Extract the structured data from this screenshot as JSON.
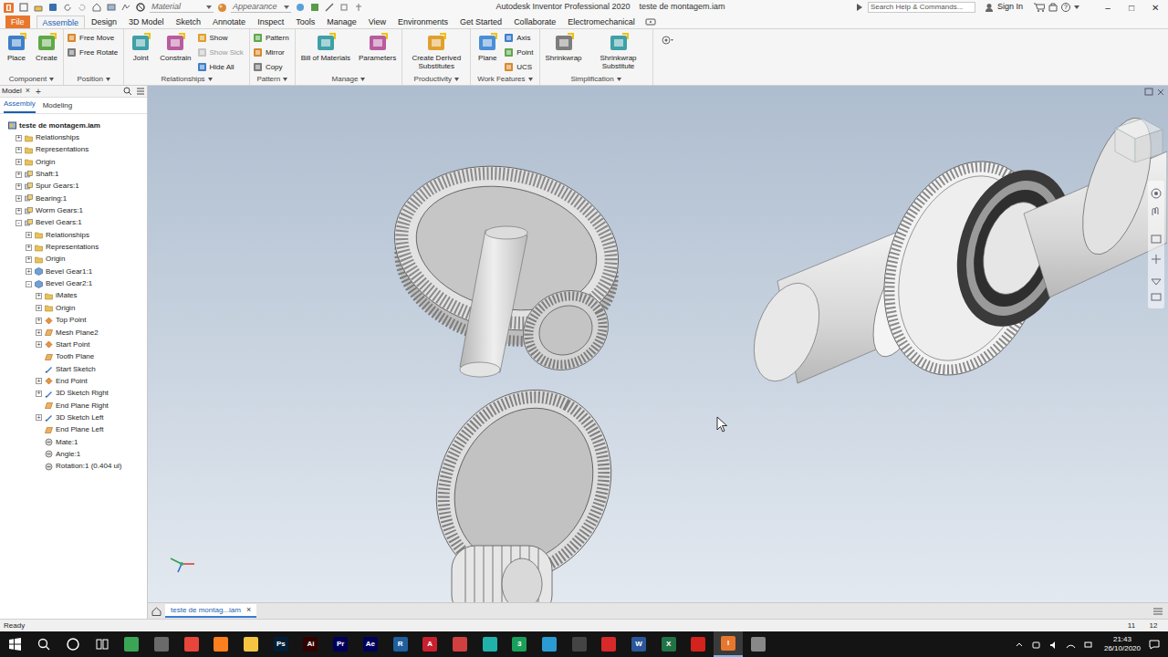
{
  "title_bar": {
    "material": "Material",
    "appearance": "Appearance",
    "title": "Autodesk Inventor Professional 2020",
    "document": "teste de montagem.iam",
    "search": {
      "placeholder": "Search Help & Commands..."
    },
    "sign_in": "Sign In",
    "help": "?",
    "window_buttons": [
      "–",
      "□",
      "✕"
    ]
  },
  "ribbon_tabs": [
    {
      "label": "File",
      "selected": false,
      "kind": "file"
    },
    {
      "label": "Assemble",
      "selected": true,
      "kind": "tab"
    },
    {
      "label": "Design",
      "selected": false,
      "kind": "tab"
    },
    {
      "label": "3D Model",
      "selected": false,
      "kind": "tab"
    },
    {
      "label": "Sketch",
      "selected": false,
      "kind": "tab"
    },
    {
      "label": "Annotate",
      "selected": false,
      "kind": "tab"
    },
    {
      "label": "Inspect",
      "selected": false,
      "kind": "tab"
    },
    {
      "label": "Tools",
      "selected": false,
      "kind": "tab"
    },
    {
      "label": "Manage",
      "selected": false,
      "kind": "tab"
    },
    {
      "label": "View",
      "selected": false,
      "kind": "tab"
    },
    {
      "label": "Environments",
      "selected": false,
      "kind": "tab"
    },
    {
      "label": "Get Started",
      "selected": false,
      "kind": "tab"
    },
    {
      "label": "Collaborate",
      "selected": false,
      "kind": "tab"
    },
    {
      "label": "Electromechanical",
      "selected": false,
      "kind": "tab"
    }
  ],
  "ribbon_groups": [
    {
      "label": "Component",
      "items": [
        {
          "label": "Place",
          "kind": "large",
          "disabled": false
        },
        {
          "label": "Create",
          "kind": "large",
          "disabled": false
        }
      ]
    },
    {
      "label": "Position",
      "items": [
        {
          "label": "Free Move",
          "kind": "small",
          "disabled": false
        },
        {
          "label": "Free Rotate",
          "kind": "small",
          "disabled": false
        }
      ]
    },
    {
      "label": "Relationships",
      "items": [
        {
          "label": "Joint",
          "kind": "large",
          "disabled": false
        },
        {
          "label": "Constrain",
          "kind": "large",
          "disabled": false
        },
        {
          "label": "Show",
          "kind": "small",
          "disabled": false
        },
        {
          "label": "Show Sick",
          "kind": "small",
          "disabled": true
        },
        {
          "label": "Hide All",
          "kind": "small",
          "disabled": false
        }
      ]
    },
    {
      "label": "Pattern",
      "items": [
        {
          "label": "Pattern",
          "kind": "small",
          "disabled": false
        },
        {
          "label": "Mirror",
          "kind": "small",
          "disabled": false
        },
        {
          "label": "Copy",
          "kind": "small",
          "disabled": false
        }
      ]
    },
    {
      "label": "Manage",
      "items": [
        {
          "label": "Bill of Materials",
          "kind": "large",
          "disabled": false
        },
        {
          "label": "Parameters",
          "kind": "large",
          "disabled": false
        }
      ]
    },
    {
      "label": "Productivity",
      "items": [
        {
          "label": "Create Derived Substitutes",
          "kind": "large",
          "disabled": false
        }
      ]
    },
    {
      "label": "Work Features",
      "items": [
        {
          "label": "Plane",
          "kind": "large",
          "disabled": false
        },
        {
          "label": "Axis",
          "kind": "small",
          "disabled": false
        },
        {
          "label": "Point",
          "kind": "small",
          "disabled": false
        },
        {
          "label": "UCS",
          "kind": "small",
          "disabled": false
        }
      ]
    },
    {
      "label": "Simplification",
      "items": [
        {
          "label": "Shrinkwrap",
          "kind": "large",
          "disabled": false
        },
        {
          "label": "Shrinkwrap Substitute",
          "kind": "large",
          "disabled": false
        }
      ]
    }
  ],
  "browser": {
    "title": "Model",
    "close": "×",
    "add": "+",
    "tabs": [
      {
        "label": "Assembly",
        "selected": true
      },
      {
        "label": "Modeling",
        "selected": false
      }
    ],
    "tree": {
      "label": "teste de montagem.iam",
      "kind": "root",
      "toggle": "",
      "children": [
        {
          "label": "Relationships",
          "kind": "folder",
          "toggle": "+",
          "children": []
        },
        {
          "label": "Representations",
          "kind": "folder",
          "toggle": "+",
          "children": []
        },
        {
          "label": "Origin",
          "kind": "folder",
          "toggle": "+",
          "children": []
        },
        {
          "label": "Shaft:1",
          "kind": "component",
          "toggle": "+",
          "children": []
        },
        {
          "label": "Spur Gears:1",
          "kind": "component",
          "toggle": "+",
          "children": []
        },
        {
          "label": "Bearing:1",
          "kind": "component",
          "toggle": "+",
          "children": []
        },
        {
          "label": "Worm Gears:1",
          "kind": "component",
          "toggle": "+",
          "children": []
        },
        {
          "label": "Bevel Gears:1",
          "kind": "component",
          "toggle": "-",
          "children": [
            {
              "label": "Relationships",
              "kind": "folder",
              "toggle": "+",
              "children": []
            },
            {
              "label": "Representations",
              "kind": "folder",
              "toggle": "+",
              "children": []
            },
            {
              "label": "Origin",
              "kind": "folder",
              "toggle": "+",
              "children": []
            },
            {
              "label": "Bevel Gear1:1",
              "kind": "part",
              "toggle": "+",
              "children": []
            },
            {
              "label": "Bevel Gear2:1",
              "kind": "part",
              "toggle": "-",
              "children": [
                {
                  "label": "iMates",
                  "kind": "folder",
                  "toggle": "+",
                  "children": []
                },
                {
                  "label": "Origin",
                  "kind": "folder",
                  "toggle": "+",
                  "children": []
                },
                {
                  "label": "Top Point",
                  "kind": "point",
                  "toggle": "+",
                  "children": []
                },
                {
                  "label": "Mesh Plane2",
                  "kind": "plane",
                  "toggle": "+",
                  "children": []
                },
                {
                  "label": "Start Point",
                  "kind": "point",
                  "toggle": "+",
                  "children": []
                },
                {
                  "label": "Tooth Plane",
                  "kind": "plane",
                  "toggle": "",
                  "children": []
                },
                {
                  "label": "Start Sketch",
                  "kind": "sketch",
                  "toggle": "",
                  "children": []
                },
                {
                  "label": "End Point",
                  "kind": "point",
                  "toggle": "+",
                  "children": []
                },
                {
                  "label": "3D Sketch Right",
                  "kind": "sketch",
                  "toggle": "+",
                  "children": []
                },
                {
                  "label": "End Plane Right",
                  "kind": "plane",
                  "toggle": "",
                  "children": []
                },
                {
                  "label": "3D Sketch Left",
                  "kind": "sketch",
                  "toggle": "+",
                  "children": []
                },
                {
                  "label": "End Plane Left",
                  "kind": "plane",
                  "toggle": "",
                  "children": []
                },
                {
                  "label": "Mate:1",
                  "kind": "constraint",
                  "toggle": "",
                  "children": []
                },
                {
                  "label": "Angle:1",
                  "kind": "constraint",
                  "toggle": "",
                  "children": []
                },
                {
                  "label": "Rotation:1 (0.404 ul)",
                  "kind": "constraint",
                  "toggle": "",
                  "children": []
                }
              ]
            }
          ]
        }
      ]
    }
  },
  "document_tabs": [
    {
      "label": "teste de montag...iam",
      "close": "×",
      "selected": true
    }
  ],
  "status_bar": {
    "text": "Ready",
    "counts": [
      "11",
      "12"
    ]
  },
  "taskbar": {
    "apps": [
      {
        "label": "",
        "color": "#3aa655",
        "selected": false
      },
      {
        "label": "",
        "color": "#6a6a6a",
        "selected": false
      },
      {
        "label": "",
        "color": "#e8453c",
        "selected": false
      },
      {
        "label": "",
        "color": "#ff7f1e",
        "selected": false
      },
      {
        "label": "",
        "color": "#f4c542",
        "selected": false
      },
      {
        "label": "Ps",
        "color": "#001e36",
        "selected": false
      },
      {
        "label": "Ai",
        "color": "#330000",
        "selected": false
      },
      {
        "label": "Pr",
        "color": "#00005b",
        "selected": false
      },
      {
        "label": "Ae",
        "color": "#00005b",
        "selected": false
      },
      {
        "label": "R",
        "color": "#1f5f9e",
        "selected": false
      },
      {
        "label": "A",
        "color": "#c8202f",
        "selected": false
      },
      {
        "label": "",
        "color": "#d04040",
        "selected": false
      },
      {
        "label": "",
        "color": "#20b2aa",
        "selected": false
      },
      {
        "label": "3",
        "color": "#1a9f5a",
        "selected": false
      },
      {
        "label": "",
        "color": "#2b9bd3",
        "selected": false
      },
      {
        "label": "",
        "color": "#444444",
        "selected": false
      },
      {
        "label": "",
        "color": "#d62a2a",
        "selected": false
      },
      {
        "label": "W",
        "color": "#2b579a",
        "selected": false
      },
      {
        "label": "X",
        "color": "#217346",
        "selected": false
      },
      {
        "label": "",
        "color": "#d4221c",
        "selected": false
      },
      {
        "label": "I",
        "color": "#e8772e",
        "selected": true
      },
      {
        "label": "",
        "color": "#888888",
        "selected": false
      }
    ],
    "time": "21:43",
    "date": "26/10/2020"
  }
}
